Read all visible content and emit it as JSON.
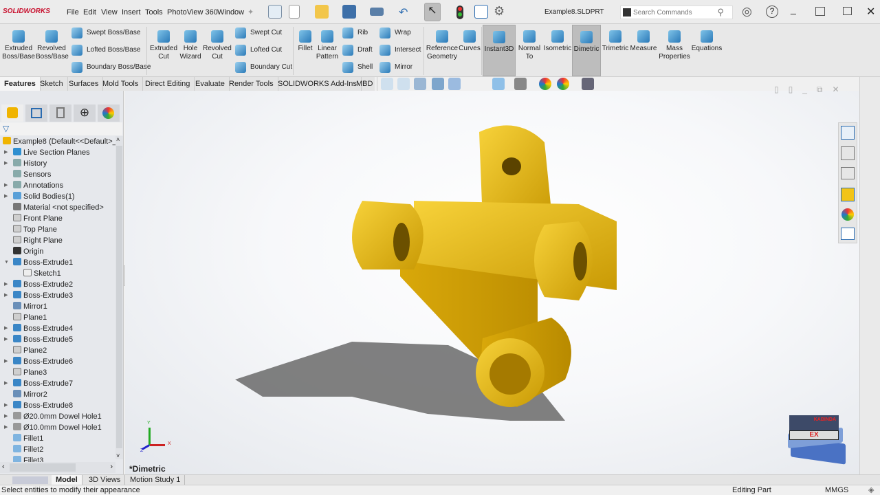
{
  "app": {
    "logo": "SOLIDWORKS",
    "document_title": "Example8.SLDPRT"
  },
  "menu": [
    "File",
    "Edit",
    "View",
    "Insert",
    "Tools",
    "PhotoView 360",
    "Window"
  ],
  "search": {
    "placeholder": "Search Commands"
  },
  "ribbon": {
    "large": [
      {
        "label": "Extruded Boss/Base"
      },
      {
        "label": "Revolved Boss/Base"
      },
      {
        "label": "Extruded Cut"
      },
      {
        "label": "Hole Wizard"
      },
      {
        "label": "Revolved Cut"
      },
      {
        "label": "Fillet"
      },
      {
        "label": "Linear Pattern"
      },
      {
        "label": "Reference Geometry"
      },
      {
        "label": "Curves"
      },
      {
        "label": "Instant3D",
        "pressed": true
      },
      {
        "label": "Normal To"
      },
      {
        "label": "Isometric"
      },
      {
        "label": "Dimetric",
        "pressed": true
      },
      {
        "label": "Trimetric"
      },
      {
        "label": "Measure"
      },
      {
        "label": "Mass Properties"
      },
      {
        "label": "Equations"
      }
    ],
    "small": [
      "Swept Boss/Base",
      "Lofted Boss/Base",
      "Boundary Boss/Base",
      "Swept Cut",
      "Lofted Cut",
      "Boundary Cut",
      "Rib",
      "Draft",
      "Shell",
      "Wrap",
      "Intersect",
      "Mirror"
    ]
  },
  "tabs": [
    {
      "label": "Features",
      "active": true
    },
    {
      "label": "Sketch"
    },
    {
      "label": "Surfaces"
    },
    {
      "label": "Mold Tools"
    },
    {
      "label": "Direct Editing"
    },
    {
      "label": "Evaluate"
    },
    {
      "label": "Render Tools"
    },
    {
      "label": "SOLIDWORKS Add-Ins"
    },
    {
      "label": "MBD"
    }
  ],
  "tree": {
    "root": "Example8  (Default<<Default>_D",
    "items": [
      {
        "label": "Live Section Planes",
        "expander": true,
        "icon": "folder"
      },
      {
        "label": "History",
        "expander": true,
        "icon": "history"
      },
      {
        "label": "Sensors",
        "icon": "sensor"
      },
      {
        "label": "Annotations",
        "expander": true,
        "icon": "annotation"
      },
      {
        "label": "Solid Bodies(1)",
        "expander": true,
        "icon": "solid-bodies"
      },
      {
        "label": "Material <not specified>",
        "icon": "material"
      },
      {
        "label": "Front Plane",
        "icon": "plane"
      },
      {
        "label": "Top Plane",
        "icon": "plane"
      },
      {
        "label": "Right Plane",
        "icon": "plane"
      },
      {
        "label": "Origin",
        "icon": "origin"
      },
      {
        "label": "Boss-Extrude1",
        "expander": true,
        "expanded": true,
        "icon": "extrude"
      },
      {
        "label": "Sketch1",
        "indent": 1,
        "icon": "sketch"
      },
      {
        "label": "Boss-Extrude2",
        "expander": true,
        "icon": "extrude"
      },
      {
        "label": "Boss-Extrude3",
        "expander": true,
        "icon": "extrude"
      },
      {
        "label": "Mirror1",
        "icon": "mirror"
      },
      {
        "label": "Plane1",
        "icon": "plane"
      },
      {
        "label": "Boss-Extrude4",
        "expander": true,
        "icon": "extrude"
      },
      {
        "label": "Boss-Extrude5",
        "expander": true,
        "icon": "extrude"
      },
      {
        "label": "Plane2",
        "icon": "plane"
      },
      {
        "label": "Boss-Extrude6",
        "expander": true,
        "icon": "extrude"
      },
      {
        "label": "Plane3",
        "icon": "plane"
      },
      {
        "label": "Boss-Extrude7",
        "expander": true,
        "icon": "extrude"
      },
      {
        "label": "Mirror2",
        "icon": "mirror"
      },
      {
        "label": "Boss-Extrude8",
        "expander": true,
        "icon": "extrude"
      },
      {
        "label": "Ø20.0mm Dowel Hole1",
        "expander": true,
        "icon": "hole"
      },
      {
        "label": "Ø10.0mm Dowel Hole1",
        "expander": true,
        "icon": "hole"
      },
      {
        "label": "Fillet1",
        "icon": "fillet"
      },
      {
        "label": "Fillet2",
        "icon": "fillet"
      },
      {
        "label": "Fillet3",
        "icon": "fillet"
      }
    ]
  },
  "viewport": {
    "view_name": "*Dimetric",
    "triad": {
      "x": "X",
      "y": "Y",
      "z": "Z"
    },
    "part_color": "#f2c417",
    "watermark": "KABINDA EX"
  },
  "bottom_tabs": [
    {
      "label": "Model",
      "active": true
    },
    {
      "label": "3D Views"
    },
    {
      "label": "Motion Study 1"
    }
  ],
  "status": {
    "message": "Select entities to modify their appearance",
    "mode": "Editing Part",
    "units": "MMGS"
  }
}
